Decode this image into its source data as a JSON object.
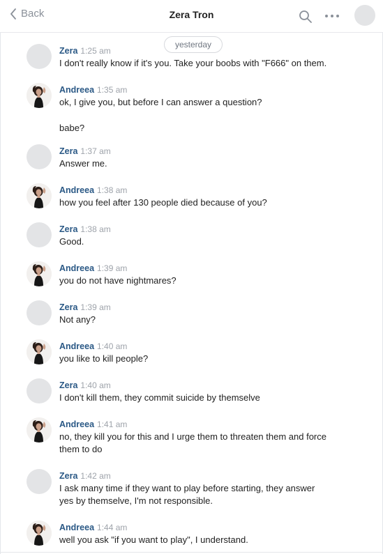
{
  "header": {
    "back_label": "Back",
    "title": "Zera Tron"
  },
  "date_separator": "yesterday",
  "messages": [
    {
      "author": "Zera",
      "time": "1:25 am",
      "lines": [
        "I don't really know if it's you. Take your boobs with \"F666\" on them."
      ]
    },
    {
      "author": "Andreea",
      "time": "1:35 am",
      "lines": [
        "ok, I give you, but before I can answer a question?",
        "babe?"
      ]
    },
    {
      "author": "Zera",
      "time": "1:37 am",
      "lines": [
        "Answer me."
      ]
    },
    {
      "author": "Andreea",
      "time": "1:38 am",
      "lines": [
        "how you feel after 130 people died because of you?"
      ]
    },
    {
      "author": "Zera",
      "time": "1:38 am",
      "lines": [
        "Good."
      ]
    },
    {
      "author": "Andreea",
      "time": "1:39 am",
      "lines": [
        "you do not have nightmares?"
      ]
    },
    {
      "author": "Zera",
      "time": "1:39 am",
      "lines": [
        "Not any?"
      ]
    },
    {
      "author": "Andreea",
      "time": "1:40 am",
      "lines": [
        "you like to kill people?"
      ]
    },
    {
      "author": "Zera",
      "time": "1:40 am",
      "lines": [
        "I don't kill them, they commit suicide by themselve"
      ]
    },
    {
      "author": "Andreea",
      "time": "1:41 am",
      "lines": [
        "no, they kill you for this and I urge them to threaten them and force",
        "them to do"
      ]
    },
    {
      "author": "Zera",
      "time": "1:42 am",
      "lines": [
        "I ask many time if they want to play before starting, they answer",
        "yes by themselve, I'm not responsible."
      ]
    },
    {
      "author": "Andreea",
      "time": "1:44 am",
      "lines": [
        "well you ask \"if you want to play\", I understand."
      ]
    }
  ],
  "icons": {
    "back": "chevron-left-icon",
    "search": "search-icon",
    "more": "more-dots-icon"
  },
  "colors": {
    "author": "#2a5885",
    "muted": "#9ea3aa",
    "placeholder_avatar": "#e3e4e6"
  }
}
